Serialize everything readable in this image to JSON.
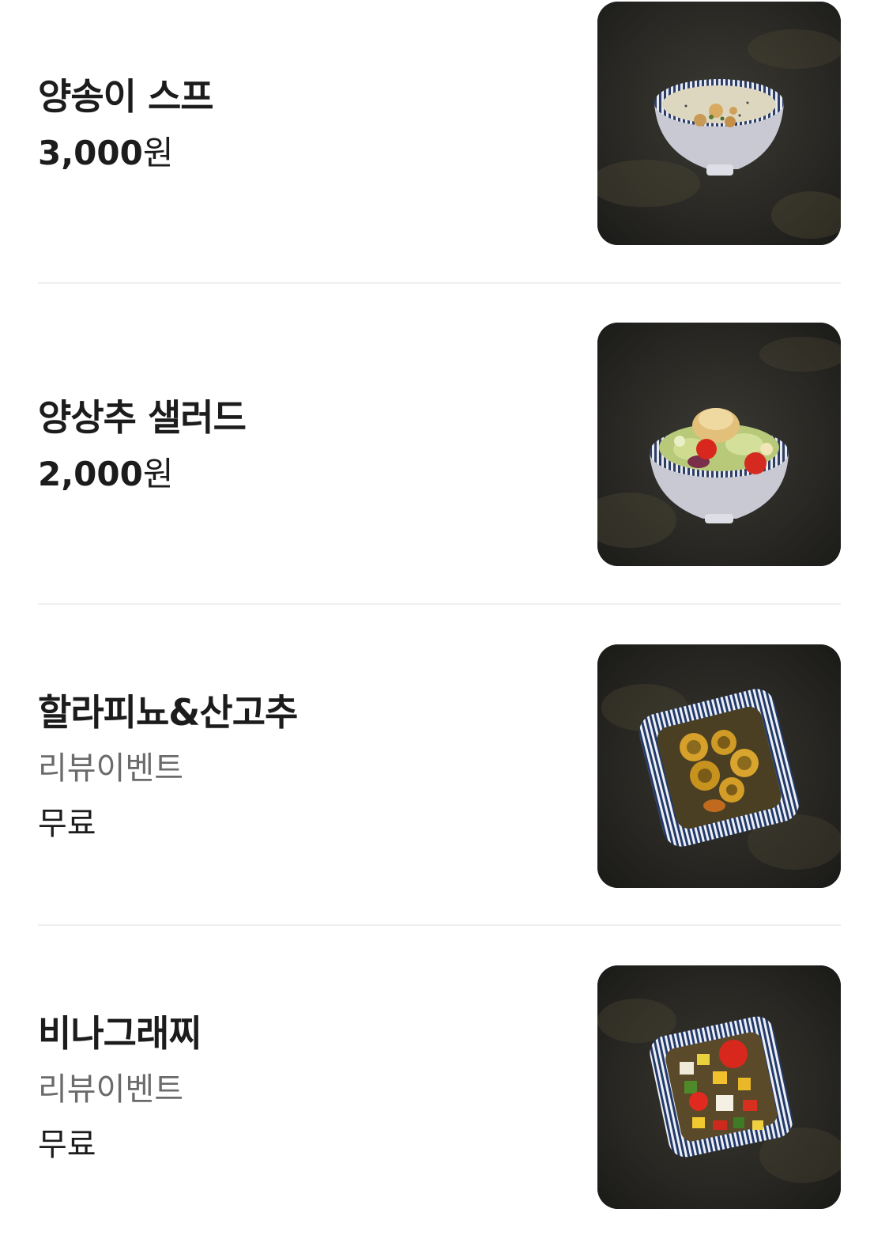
{
  "menu": {
    "items": [
      {
        "name": "양송이 스프",
        "price": "3,000",
        "price_unit": "원",
        "image_icon": "mushroom-soup-bowl-photo"
      },
      {
        "name": "양상추 샐러드",
        "price": "2,000",
        "price_unit": "원",
        "image_icon": "lettuce-salad-bowl-photo"
      },
      {
        "name": "할라피뇨&산고추",
        "event": "리뷰이벤트",
        "free": "무료",
        "image_icon": "jalapeno-pickle-dish-photo"
      },
      {
        "name": "비나그래찌",
        "event": "리뷰이벤트",
        "free": "무료",
        "image_icon": "vinaigrette-salsa-dish-photo"
      }
    ]
  },
  "colors": {
    "text_primary": "#1c1c1c",
    "text_secondary": "#6b6b6b",
    "divider": "#efefef",
    "photo_background": "#2a2a26"
  }
}
